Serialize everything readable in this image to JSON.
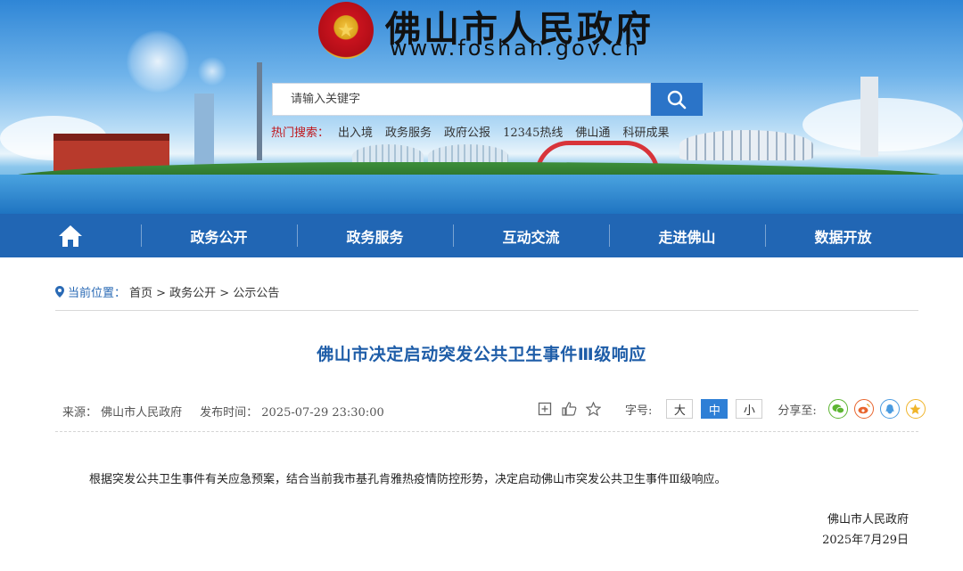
{
  "header": {
    "title": "佛山市人民政府",
    "url": "www.foshan.gov.cn",
    "emblem_icon": "national-emblem-icon",
    "search": {
      "placeholder": "请输入关键字",
      "button_icon": "search-icon"
    },
    "hot": {
      "label": "热门搜索：",
      "items": [
        "出入境",
        "政务服务",
        "政府公报",
        "12345热线",
        "佛山通",
        "科研成果"
      ]
    }
  },
  "nav": {
    "home_icon": "home-icon",
    "items": [
      "政务公开",
      "政务服务",
      "互动交流",
      "走进佛山",
      "数据开放"
    ]
  },
  "breadcrumb": {
    "label": "当前位置：",
    "path": "首页 > 政务公开 > 公示公告"
  },
  "article": {
    "title": "佛山市决定启动突发公共卫生事件Ⅲ级响应",
    "source": "来源：  佛山市人民政府",
    "publish_time": "发布时间：  2025-07-29 23:30:00",
    "body": "根据突发公共卫生事件有关应急预案，结合当前我市基孔肯雅热疫情防控形势，决定启动佛山市突发公共卫生事件Ⅲ级响应。",
    "signature_org": "佛山市人民政府",
    "signature_date": "2025年7月29日"
  },
  "tools": {
    "font_size_label": "字号:",
    "font_sizes": [
      "大",
      "中",
      "小"
    ],
    "active_font_size": "中",
    "share_label": "分享至:"
  },
  "colors": {
    "nav_bg": "#2166b4",
    "title_blue": "#1e5da8",
    "hot_red": "#c0171d",
    "accent": "#2e7fd6"
  }
}
